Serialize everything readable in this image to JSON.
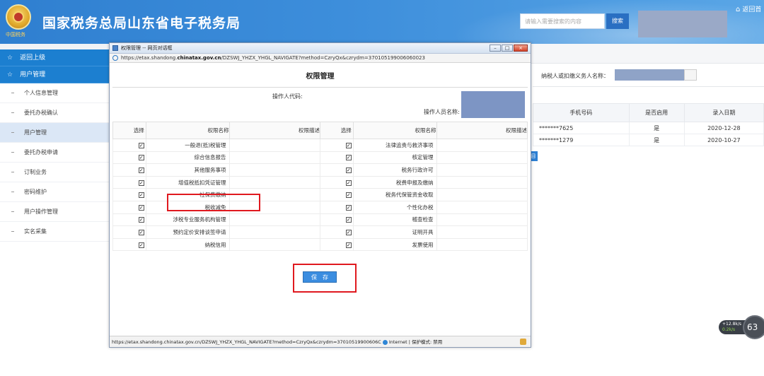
{
  "header": {
    "emblem_text": "中国税务",
    "title": "国家税务总局山东省电子税务局",
    "search_placeholder": "请输入需要搜索的内容",
    "search_button": "搜索",
    "home_link": "返回首"
  },
  "sidebar": {
    "back": "返回上级",
    "section": "用户管理",
    "items": [
      {
        "label": "个人信息管理"
      },
      {
        "label": "委托办税确认"
      },
      {
        "label": "用户管理"
      },
      {
        "label": "委托办税申请"
      },
      {
        "label": "订制业务"
      },
      {
        "label": "密码维护"
      },
      {
        "label": "用户操作管理"
      },
      {
        "label": "实名采集"
      }
    ]
  },
  "background": {
    "filter_label": "纳税人或扣缴义务人名称：",
    "columns": [
      "手机号码",
      "是否启用",
      "录入日期"
    ],
    "rows": [
      [
        "*******7625",
        "是",
        "2020-12-28"
      ],
      [
        "*******1279",
        "是",
        "2020-10-27"
      ]
    ],
    "side_tab": "目"
  },
  "speed": {
    "up": "+12.8k/s",
    "down": "0.2k/s",
    "value": "63"
  },
  "dialog": {
    "title": "权限管理 -- 网页对话框",
    "url_prefix": "https://etax.shandong.",
    "url_domain": "chinatax.gov.cn",
    "url_suffix": "/DZSWJ_YHZX_YHGL_NAVIGATE?method=CzryQx&czrydm=370105199006060023",
    "heading": "权限管理",
    "operator_code_label": "操作人代码:",
    "operator_name_label": "操作人员名称:",
    "columns": {
      "select": "选择",
      "name": "权限名称",
      "desc": "权限描述"
    },
    "rows": [
      {
        "left": "一般退(抵)税管理",
        "right": "法律追责与救济事项"
      },
      {
        "left": "综合信息报告",
        "right": "核定管理"
      },
      {
        "left": "其他服务事项",
        "right": "税务行政许可"
      },
      {
        "left": "增值税抵扣凭证管理",
        "right": "税费申报及缴纳"
      },
      {
        "left": "社保费缴纳",
        "right": "税务代保管资金收取"
      },
      {
        "left": "税收减免",
        "right": "个性化办税"
      },
      {
        "left": "涉税专业服务机构管理",
        "right": "稽查检查"
      },
      {
        "left": "预约定价安排谈签申请",
        "right": "证明开具"
      },
      {
        "left": "纳税信用",
        "right": "发票使用"
      }
    ],
    "check_mark": "✓",
    "save_button": "保　存",
    "status_url": "https://etax.shandong.chinatax.gov.cn/DZSWJ_YHZX_YHGL_NAVIGATE?method=CzryQx&czrydm=37010519900606C",
    "status_zone": "Internet | 保护模式: 禁用"
  }
}
